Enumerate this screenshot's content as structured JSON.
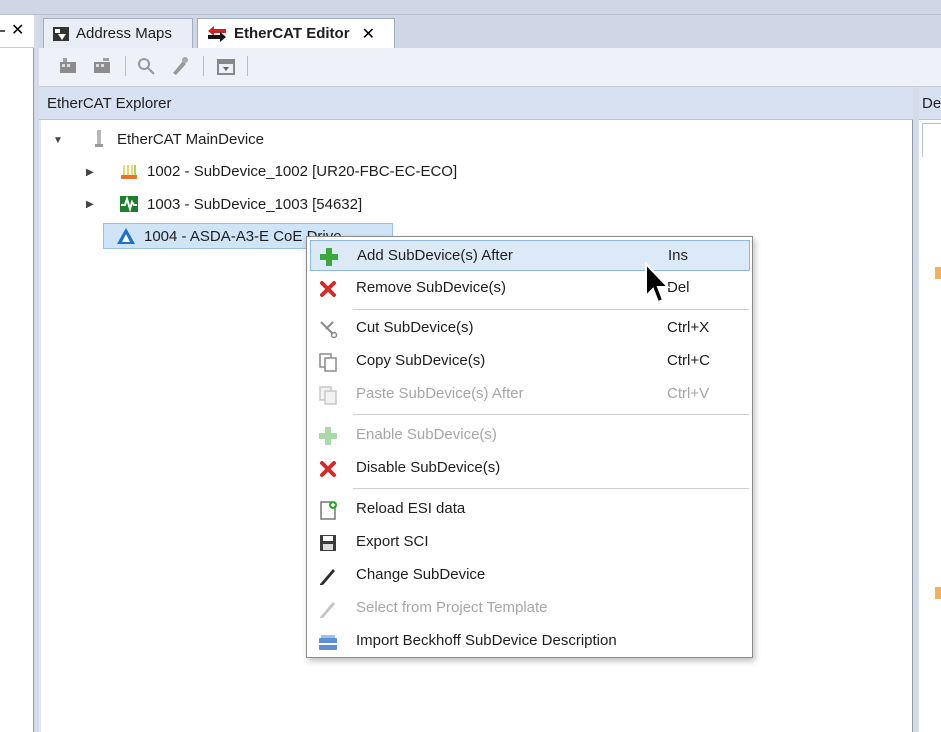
{
  "left_panel": {
    "close_label": "✕"
  },
  "tabs": [
    {
      "label": "Address Maps",
      "active": false
    },
    {
      "label": "EtherCAT Editor",
      "active": true,
      "close_label": "✕"
    }
  ],
  "explorer": {
    "title": "EtherCAT Explorer",
    "tree": [
      {
        "label": "EtherCAT MainDevice",
        "expanded": true
      },
      {
        "label": "1002 - SubDevice_1002 [UR20-FBC-EC-ECO]",
        "expanded": false
      },
      {
        "label": "1003 - SubDevice_1003 [54632]",
        "expanded": false
      },
      {
        "label": "1004 - ASDA-A3-E CoE Drive",
        "selected": true
      }
    ]
  },
  "right_panel": {
    "title": "De"
  },
  "context_menu": {
    "items": [
      {
        "label": "Add SubDevice(s) After",
        "shortcut": "Ins",
        "icon": "green-plus-icon",
        "enabled": true,
        "hover": true
      },
      {
        "label": "Remove SubDevice(s)",
        "shortcut": "Del",
        "icon": "red-x-icon",
        "enabled": true
      },
      {
        "label": "Cut SubDevice(s)",
        "shortcut": "Ctrl+X",
        "icon": "scissors-icon",
        "enabled": true
      },
      {
        "label": "Copy SubDevice(s)",
        "shortcut": "Ctrl+C",
        "icon": "copy-icon",
        "enabled": true
      },
      {
        "label": "Paste SubDevice(s) After",
        "shortcut": "Ctrl+V",
        "icon": "paste-icon",
        "enabled": false
      },
      {
        "label": "Enable SubDevice(s)",
        "shortcut": "",
        "icon": "green-plus-icon",
        "enabled": false
      },
      {
        "label": "Disable SubDevice(s)",
        "shortcut": "",
        "icon": "red-x-icon",
        "enabled": true
      },
      {
        "label": "Reload ESI data",
        "shortcut": "",
        "icon": "reload-document-icon",
        "enabled": true
      },
      {
        "label": "Export SCI",
        "shortcut": "",
        "icon": "floppy-disk-icon",
        "enabled": true
      },
      {
        "label": "Change SubDevice",
        "shortcut": "",
        "icon": "pencil-icon",
        "enabled": true
      },
      {
        "label": "Select from Project Template",
        "shortcut": "",
        "icon": "pencil-icon",
        "enabled": false
      },
      {
        "label": "Import Beckhoff SubDevice Description",
        "shortcut": "",
        "icon": "import-device-icon",
        "enabled": true
      }
    ]
  },
  "colors": {
    "selection": "#cfe4f6",
    "menu_hover": "#dceaf7",
    "header": "#d8e1f1",
    "disabled_text": "#a6a6a6"
  }
}
